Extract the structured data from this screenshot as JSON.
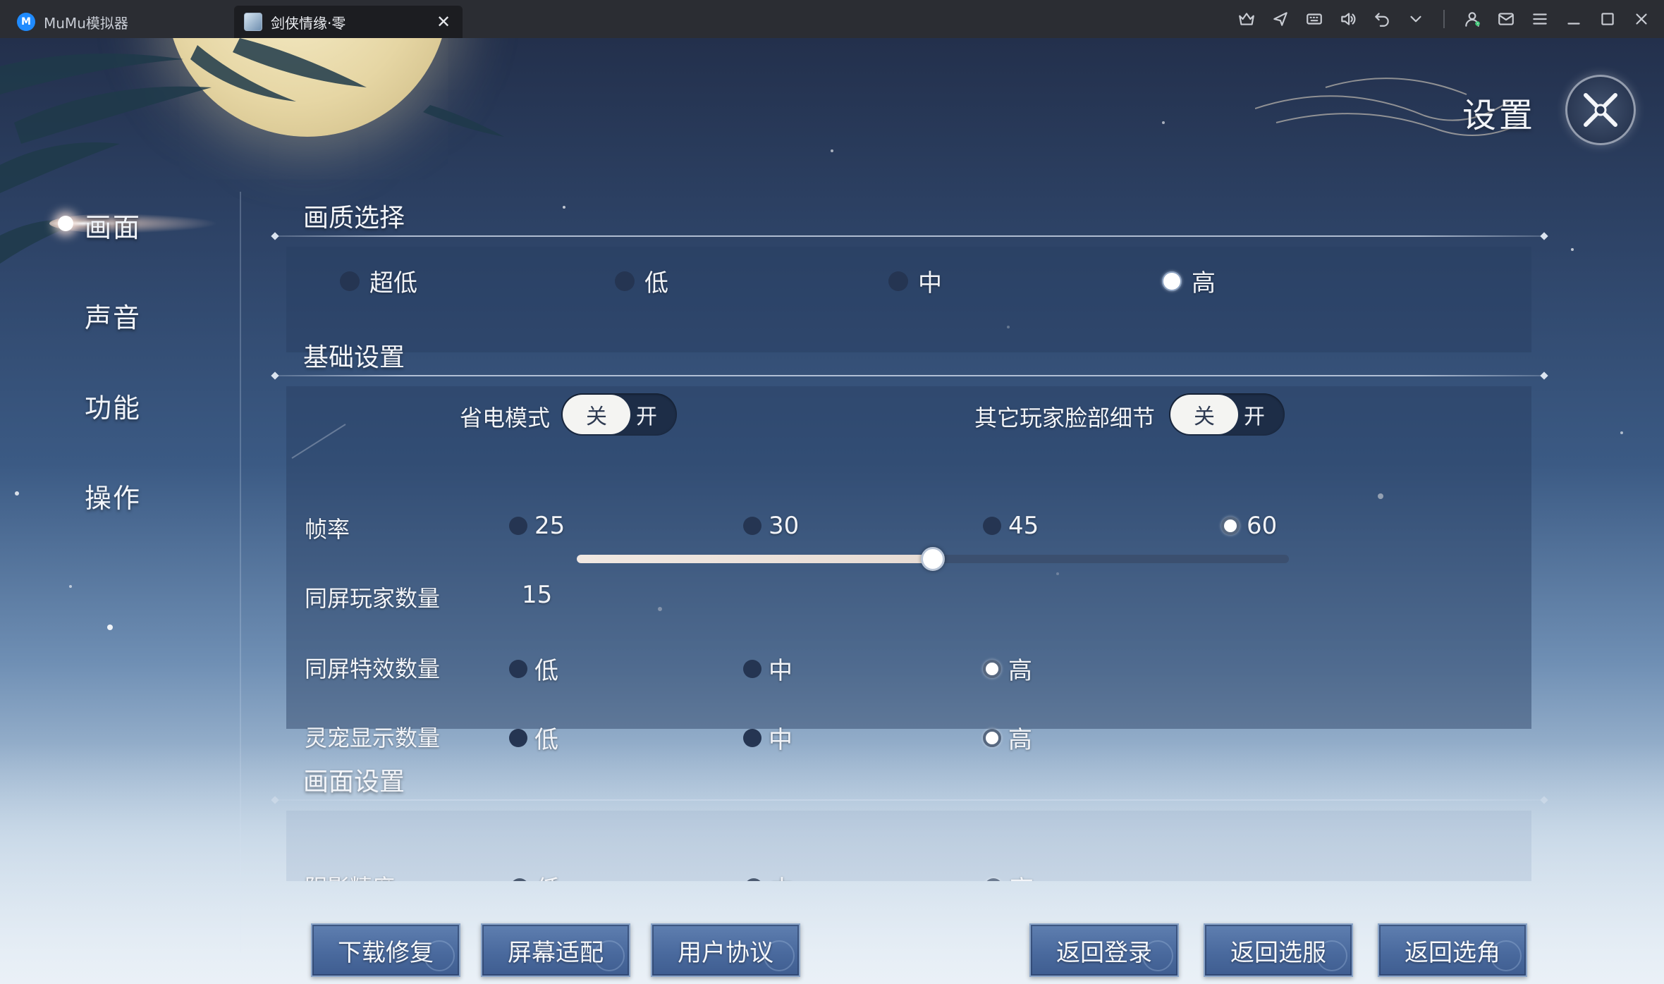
{
  "window": {
    "app_tab_label": "MuMu模拟器",
    "game_tab_label": "剑侠情缘·零",
    "close_tab_glyph": "✕",
    "logo_letter": "M"
  },
  "header": {
    "title": "设置"
  },
  "nav": {
    "items": [
      {
        "label": "画面",
        "active": true
      },
      {
        "label": "声音",
        "active": false
      },
      {
        "label": "功能",
        "active": false
      },
      {
        "label": "操作",
        "active": false
      }
    ]
  },
  "quality": {
    "title": "画质选择",
    "options": [
      "超低",
      "低",
      "中",
      "高"
    ],
    "selected": "高"
  },
  "basic": {
    "title": "基础设置",
    "power_saving": {
      "label": "省电模式",
      "off": "关",
      "on": "开",
      "state": "关"
    },
    "face_detail": {
      "label": "其它玩家脸部细节",
      "off": "关",
      "on": "开",
      "state": "关"
    },
    "framerate": {
      "label": "帧率",
      "options": [
        "25",
        "30",
        "45",
        "60"
      ],
      "selected": "60"
    },
    "players_on_screen": {
      "label": "同屏玩家数量",
      "value": "15",
      "fraction": 0.5
    },
    "effects_on_screen": {
      "label": "同屏特效数量",
      "options": [
        "低",
        "中",
        "高"
      ],
      "selected": "高"
    },
    "pets_displayed": {
      "label": "灵宠显示数量",
      "options": [
        "低",
        "中",
        "高"
      ],
      "selected": "高"
    }
  },
  "display": {
    "title": "画面设置",
    "shadow": {
      "label": "阴影精度",
      "options": [
        "低",
        "中",
        "高"
      ],
      "selected": "高"
    }
  },
  "buttons": {
    "download_repair": "下载修复",
    "screen_fit": "屏幕适配",
    "user_agreement": "用户协议",
    "back_login": "返回登录",
    "back_server": "返回选服",
    "back_character": "返回选角"
  },
  "colors": {
    "accent": "#4a6a9e",
    "radio_on": "#ffffff",
    "radio_off": "#253552"
  }
}
